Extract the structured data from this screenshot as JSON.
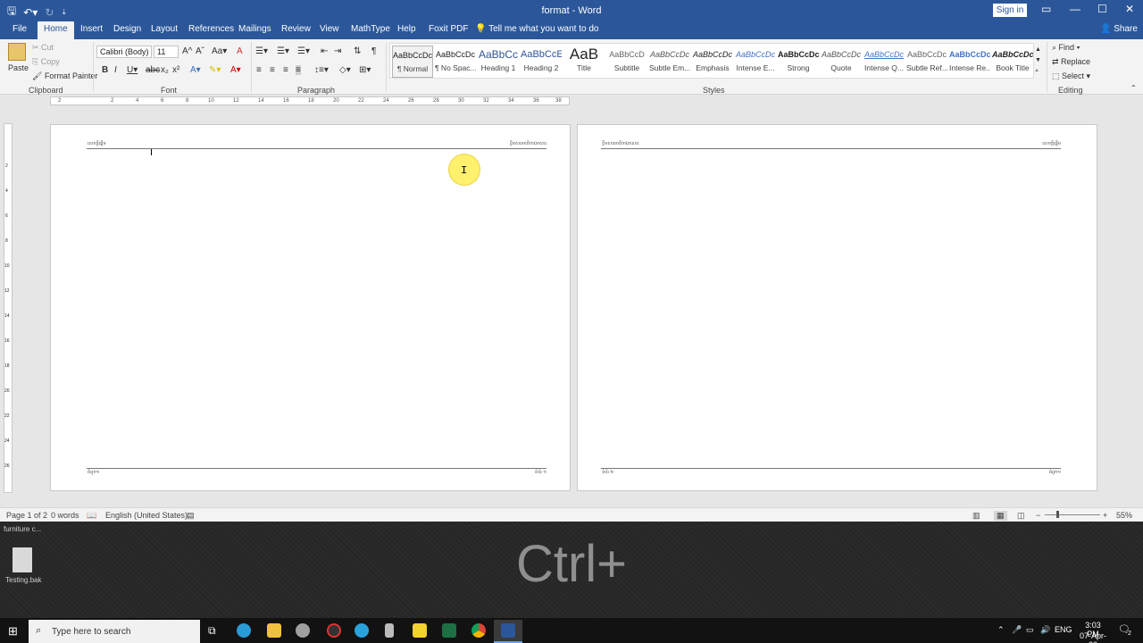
{
  "titlebar": {
    "doc_title": "format - Word",
    "signin": "Sign in"
  },
  "tabs": [
    "File",
    "Home",
    "Insert",
    "Design",
    "Layout",
    "References",
    "Mailings",
    "Review",
    "View",
    "MathType",
    "Help",
    "Foxit PDF"
  ],
  "tell_me": "Tell me what you want to do",
  "share": "Share",
  "clipboard": {
    "paste": "Paste",
    "cut": "Cut",
    "copy": "Copy",
    "format_painter": "Format Painter",
    "group": "Clipboard"
  },
  "font": {
    "name": "Calibri (Body)",
    "size": "11",
    "group": "Font"
  },
  "paragraph": {
    "group": "Paragraph"
  },
  "styles": {
    "group": "Styles",
    "items": [
      {
        "preview": "AaBbCcDc",
        "name": "¶ Normal"
      },
      {
        "preview": "AaBbCcDc",
        "name": "¶ No Spac..."
      },
      {
        "preview": "AaBbCc",
        "name": "Heading 1"
      },
      {
        "preview": "AaBbCcE",
        "name": "Heading 2"
      },
      {
        "preview": "AaB",
        "name": "Title"
      },
      {
        "preview": "AaBbCcD",
        "name": "Subtitle"
      },
      {
        "preview": "AaBbCcDc",
        "name": "Subtle Em..."
      },
      {
        "preview": "AaBbCcDc",
        "name": "Emphasis"
      },
      {
        "preview": "AaBbCcDc",
        "name": "Intense E..."
      },
      {
        "preview": "AaBbCcDc",
        "name": "Strong"
      },
      {
        "preview": "AaBbCcDc",
        "name": "Quote"
      },
      {
        "preview": "AaBbCcDc",
        "name": "Intense Q..."
      },
      {
        "preview": "AaBbCcDc",
        "name": "Subtle Ref..."
      },
      {
        "preview": "AaBbCcDc",
        "name": "Intense Re..."
      },
      {
        "preview": "AaBbCcDc",
        "name": "Book Title"
      }
    ]
  },
  "editing": {
    "find": "Find",
    "replace": "Replace",
    "select": "Select",
    "group": "Editing"
  },
  "ruler": [
    "2",
    "2",
    "4",
    "6",
    "8",
    "10",
    "12",
    "14",
    "16",
    "18",
    "20",
    "22",
    "24",
    "26",
    "28",
    "30",
    "32",
    "34",
    "36",
    "38"
  ],
  "vruler": [
    "2",
    "4",
    "6",
    "8",
    "10",
    "12",
    "14",
    "16",
    "18",
    "20",
    "22",
    "24",
    "26"
  ],
  "page1": {
    "header_left": "សេចក្តីផ្តើម",
    "header_right": "ខ្លឹមសារមាតិកាឯកសារ",
    "footer_left": "ជំពូក១",
    "footer_right": "ទំព័រ ១"
  },
  "page2": {
    "header_left": "ខ្លឹមសារមាតិកាឯកសារ",
    "header_right": "សេចក្តីផ្តើម",
    "footer_left": "ទំព័រ ២",
    "footer_right": "ជំពូក១"
  },
  "status": {
    "page": "Page 1 of 2",
    "words": "0 words",
    "language": "English (United States)",
    "zoom": "55%"
  },
  "desktop": {
    "top_label": "furniture c...",
    "file_label": "Testing.bak",
    "overlay": "Ctrl+"
  },
  "taskbar": {
    "search": "Type here to search",
    "lang": "ENG",
    "time": "3:03 PM",
    "date": "07-Apr-23",
    "notif": "2"
  }
}
